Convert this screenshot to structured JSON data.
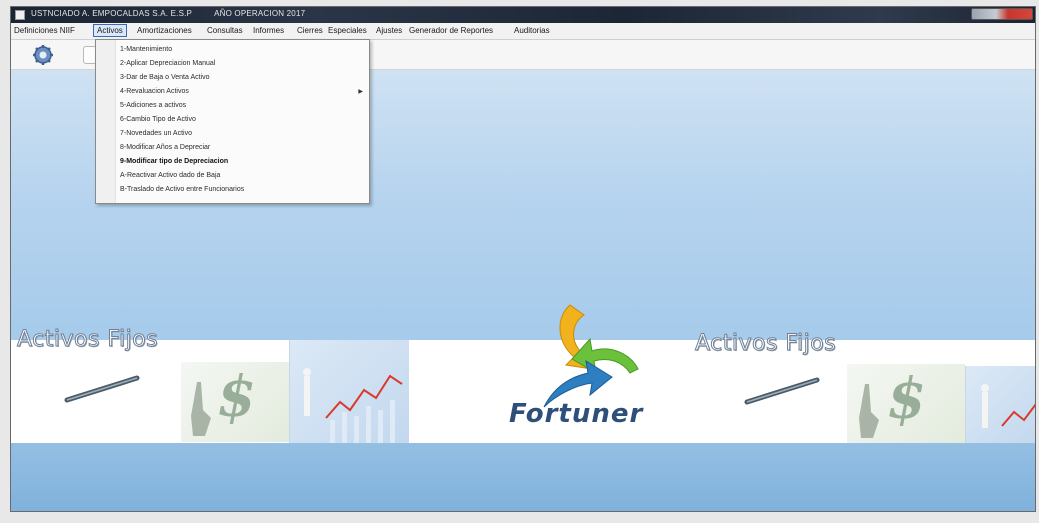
{
  "window": {
    "title_left": "USTNCIADO A. EMPOCALDAS S.A. E.S.P",
    "title_right": "AÑO OPERACION 2017"
  },
  "menu": {
    "items": [
      {
        "label": "Definiciones NIIF"
      },
      {
        "label": "Activos"
      },
      {
        "label": "Amortizaciones"
      },
      {
        "label": "Consultas"
      },
      {
        "label": "Informes"
      },
      {
        "label": "Cierres"
      },
      {
        "label": "Especiales"
      },
      {
        "label": "Ajustes"
      },
      {
        "label": "Generador de Reportes"
      },
      {
        "label": "Auditorias"
      }
    ]
  },
  "dropdown": {
    "items": [
      {
        "label": "1-Mantenimiento"
      },
      {
        "label": "2-Aplicar Depreciacion Manual"
      },
      {
        "label": "3-Dar de Baja o Venta Activo"
      },
      {
        "label": "4-Revaluacion Activos"
      },
      {
        "label": "5-Adiciones a activos"
      },
      {
        "label": "6-Cambio Tipo de Activo"
      },
      {
        "label": "7-Novedades un Activo"
      },
      {
        "label": "8-Modificar Años a Depreciar"
      },
      {
        "label": "9-Modificar tipo de Depreciacion"
      },
      {
        "label": "A-Reactivar Activo dado de Baja"
      },
      {
        "label": "B-Traslado de Activo entre Funcionarios"
      }
    ]
  },
  "banner": {
    "title_left": "Activos Fijos",
    "title_right": "Activos Fijos",
    "dollar": "$",
    "logo_text": "Fortuner"
  },
  "colors": {
    "desktop": "#a6cbeb",
    "logo_yellow": "#f2b21c",
    "logo_green": "#6cc13c",
    "logo_blue": "#2d7fc1",
    "logo_text": "#2e4f7a"
  }
}
